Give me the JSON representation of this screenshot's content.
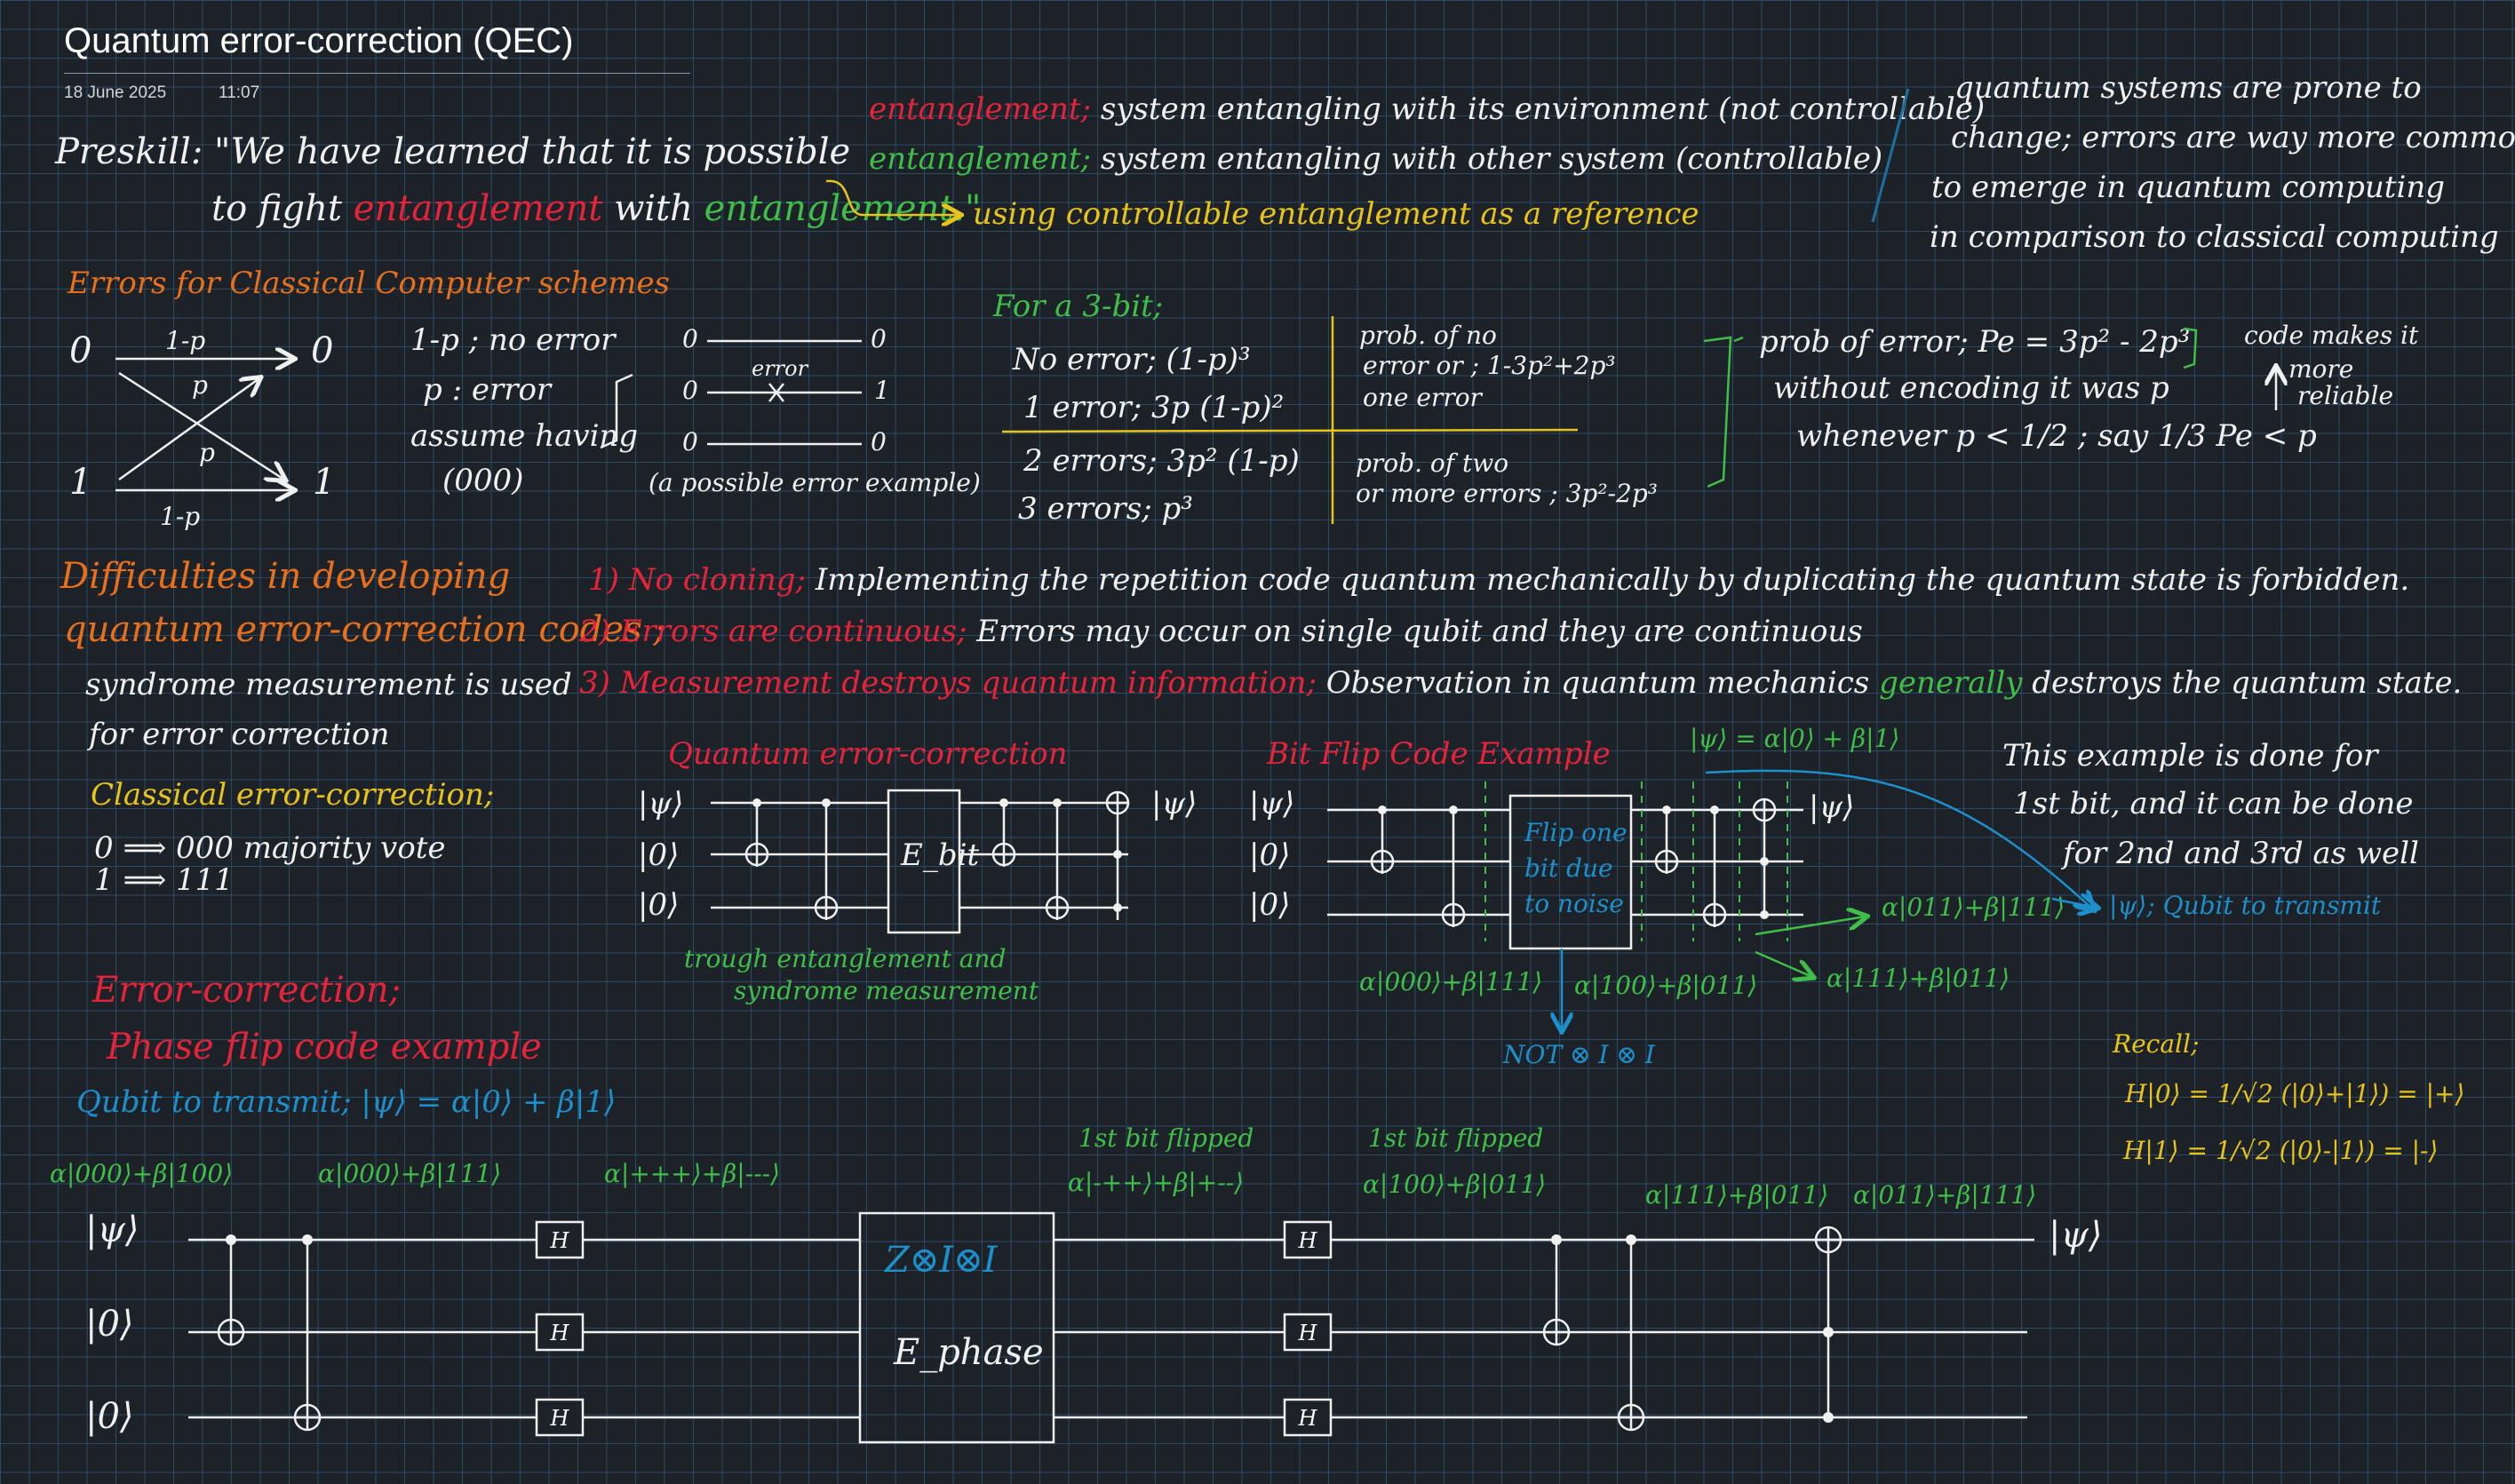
{
  "header": {
    "title": "Quantum error-correction (QEC)",
    "date": "18 June 2025",
    "time": "11:07"
  },
  "preskill": {
    "line1": "Preskill: \"We have learned that it is possible",
    "line2a": "to fight",
    "line2b": "entanglement",
    "line2c": "with",
    "line2d": "entanglement.\""
  },
  "entanglement_notes": {
    "word1": "entanglement;",
    "rest1": "system entangling with its environment (not controllable)",
    "word2": "entanglement;",
    "rest2": "system entangling with other system (controllable)",
    "reference": "using controllable entanglement as a reference"
  },
  "prone_note": [
    "quantum systems are prone to",
    "change; errors are way more common",
    "to emerge in quantum computing",
    "in comparison to classical computing"
  ],
  "classical": {
    "title": "Errors for Classical Computer schemes",
    "in0": "0",
    "in1": "1",
    "out0": "0",
    "out1": "1",
    "top": "1-p",
    "bottom": "1-p",
    "cross1": "p",
    "cross2": "p",
    "notes": [
      "1-p ; no error",
      "p : error",
      "assume having",
      "(000)"
    ],
    "bits": [
      "0",
      "0",
      "0"
    ],
    "bits_out": [
      "0",
      "1",
      "0"
    ],
    "error_label": "error",
    "example": "(a possible error example)"
  },
  "three_bit": {
    "title": "For a 3-bit;",
    "rows": [
      "No error; (1-p)³",
      "1 error; 3p (1-p)²",
      "2 errors; 3p² (1-p)",
      "3 errors; p³"
    ],
    "right_top": [
      "prob. of no",
      "error or ; 1-3p²+2p³",
      "one error"
    ],
    "right_bottom": [
      "prob. of two",
      "or more errors ; 3p²-2p³"
    ],
    "pe": [
      "prob of error; Pe = 3p² - 2p³",
      "without encoding it was p",
      "whenever p < 1/2 ; say 1/3    Pe < p"
    ],
    "reliable": [
      "code makes it",
      "more",
      "reliable"
    ]
  },
  "difficulties": {
    "title": [
      "Difficulties in developing",
      "quantum error-correction codes ;"
    ],
    "syndrome": [
      "syndrome measurement is used",
      "for error correction"
    ],
    "d1a": "1) No cloning;",
    "d1b": "Implementing the repetition code quantum mechanically by duplicating the quantum state is forbidden.",
    "d2a": "2) Errors are continuous;",
    "d2b": "Errors may occur on single qubit and they are continuous",
    "d3a": "3) Measurement destroys quantum information;",
    "d3b": "Observation in quantum mechanics",
    "d3c": "generally",
    "d3d": "destroys the quantum state."
  },
  "classical_ec": {
    "title": "Classical error-correction;",
    "l1": "0 ⟹ 000   majority vote",
    "l2": "1 ⟹ 111"
  },
  "qec_circuit": {
    "title": "Quantum error-correction",
    "inputs": [
      "|ψ⟩",
      "|0⟩",
      "|0⟩"
    ],
    "output": "|ψ⟩",
    "box": "E_bit",
    "caption": [
      "trough entanglement and",
      "syndrome measurement"
    ]
  },
  "bit_flip": {
    "title": "Bit Flip Code Example",
    "inputs": [
      "|ψ⟩",
      "|0⟩",
      "|0⟩"
    ],
    "output": "|ψ⟩",
    "box": [
      "Flip one",
      "bit due",
      "to noise"
    ],
    "state_top": "|ψ⟩ = α|0⟩ + β|1⟩",
    "state_in": "α|000⟩+β|111⟩",
    "state_mid": "α|100⟩+β|011⟩",
    "state_r1": "α|011⟩+β|111⟩",
    "state_r2": "α|111⟩+β|011⟩",
    "not_label": "NOT ⊗ I ⊗ I",
    "note": [
      "This example is done for",
      "1st bit, and it can be done",
      "for 2nd and 3rd as well"
    ],
    "qubit_note": "|ψ⟩; Qubit to transmit"
  },
  "phase_flip": {
    "title": "Error-correction;",
    "subtitle": "Phase flip code example",
    "qubit": "Qubit to transmit; |ψ⟩ = α|0⟩ + β|1⟩",
    "inputs": [
      "|ψ⟩",
      "|0⟩",
      "|0⟩"
    ],
    "output": "|ψ⟩",
    "s1": "α|000⟩+β|100⟩",
    "s2": "α|000⟩+β|111⟩",
    "s3": "α|+++⟩+β|---⟩",
    "flip1": "1st bit flipped",
    "s4": "α|-++⟩+β|+--⟩",
    "flip2": "1st bit flipped",
    "s5": "α|100⟩+β|011⟩",
    "s6": "α|111⟩+β|011⟩",
    "s7": "α|011⟩+β|111⟩",
    "box_top": "Z⊗I⊗I",
    "box_bottom": "E_phase",
    "h": "H"
  },
  "recall": {
    "title": "Recall;",
    "l1": "H|0⟩ = 1/√2 (|0⟩+|1⟩) = |+⟩",
    "l2": "H|1⟩ = 1/√2 (|0⟩-|1⟩) = |-⟩"
  }
}
